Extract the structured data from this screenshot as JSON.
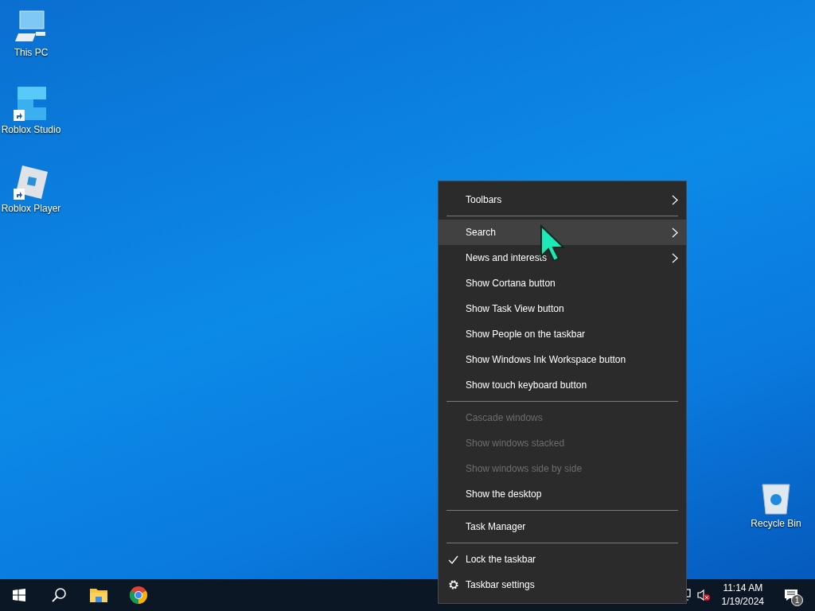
{
  "desktop_icons": [
    {
      "kind": "pc",
      "label": "This PC",
      "shortcut": false
    },
    {
      "kind": "studio",
      "label": "Roblox Studio",
      "shortcut": true
    },
    {
      "kind": "player",
      "label": "Roblox Player",
      "shortcut": true
    },
    {
      "kind": "recycle",
      "label": "Recycle Bin",
      "shortcut": false
    }
  ],
  "context_menu": [
    {
      "kind": "item",
      "label": "Toolbars",
      "submenu": true,
      "selected": false,
      "disabled": false,
      "checked": false
    },
    {
      "kind": "separator"
    },
    {
      "kind": "item",
      "label": "Search",
      "submenu": true,
      "selected": true,
      "disabled": false,
      "checked": false
    },
    {
      "kind": "item",
      "label": "News and interests",
      "submenu": true,
      "selected": false,
      "disabled": false,
      "checked": false
    },
    {
      "kind": "item",
      "label": "Show Cortana button",
      "submenu": false,
      "selected": false,
      "disabled": false,
      "checked": false
    },
    {
      "kind": "item",
      "label": "Show Task View button",
      "submenu": false,
      "selected": false,
      "disabled": false,
      "checked": false
    },
    {
      "kind": "item",
      "label": "Show People on the taskbar",
      "submenu": false,
      "selected": false,
      "disabled": false,
      "checked": false
    },
    {
      "kind": "item",
      "label": "Show Windows Ink Workspace button",
      "submenu": false,
      "selected": false,
      "disabled": false,
      "checked": false
    },
    {
      "kind": "item",
      "label": "Show touch keyboard button",
      "submenu": false,
      "selected": false,
      "disabled": false,
      "checked": false
    },
    {
      "kind": "separator"
    },
    {
      "kind": "item",
      "label": "Cascade windows",
      "submenu": false,
      "selected": false,
      "disabled": true,
      "checked": false
    },
    {
      "kind": "item",
      "label": "Show windows stacked",
      "submenu": false,
      "selected": false,
      "disabled": true,
      "checked": false
    },
    {
      "kind": "item",
      "label": "Show windows side by side",
      "submenu": false,
      "selected": false,
      "disabled": true,
      "checked": false
    },
    {
      "kind": "item",
      "label": "Show the desktop",
      "submenu": false,
      "selected": false,
      "disabled": false,
      "checked": false
    },
    {
      "kind": "separator"
    },
    {
      "kind": "item",
      "label": "Task Manager",
      "submenu": false,
      "selected": false,
      "disabled": false,
      "checked": false
    },
    {
      "kind": "separator"
    },
    {
      "kind": "item",
      "label": "Lock the taskbar",
      "submenu": false,
      "selected": false,
      "disabled": false,
      "checked": true
    },
    {
      "kind": "settings",
      "label": "Taskbar settings",
      "submenu": false,
      "selected": false,
      "disabled": false,
      "checked": false
    }
  ],
  "taskbar": {
    "apps": [
      {
        "kind": "start"
      },
      {
        "kind": "search"
      },
      {
        "kind": "explorer"
      },
      {
        "kind": "chrome"
      }
    ],
    "tray": {
      "time": "11:14 AM",
      "date": "1/19/2024",
      "notification_count": "1",
      "sound_muted": true
    }
  }
}
